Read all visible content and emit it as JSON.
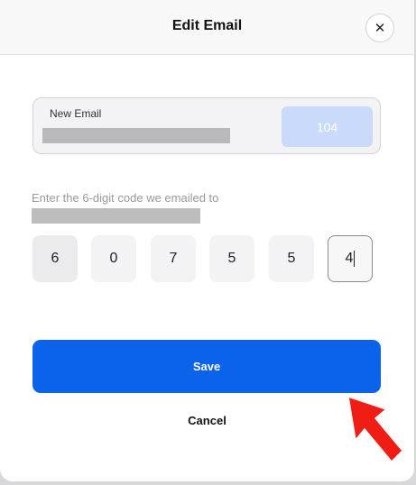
{
  "dialog": {
    "title": "Edit Email",
    "close_icon_glyph": "✕"
  },
  "email": {
    "label": "New Email",
    "value_redacted": "••••••••••••",
    "resend_countdown": "104"
  },
  "verification": {
    "prompt": "Enter the 6-digit code we emailed to",
    "email_redacted": "••••••••••••",
    "digits": [
      "6",
      "0",
      "7",
      "5",
      "5",
      "4"
    ],
    "active_index": 5
  },
  "actions": {
    "save_label": "Save",
    "cancel_label": "Cancel"
  },
  "annotation": {
    "arrow_icon": "red-pointer-arrow-icon",
    "color": "#f01d14"
  },
  "colors": {
    "primary": "#0b63eb",
    "countdown_bg": "#c9dafb"
  }
}
